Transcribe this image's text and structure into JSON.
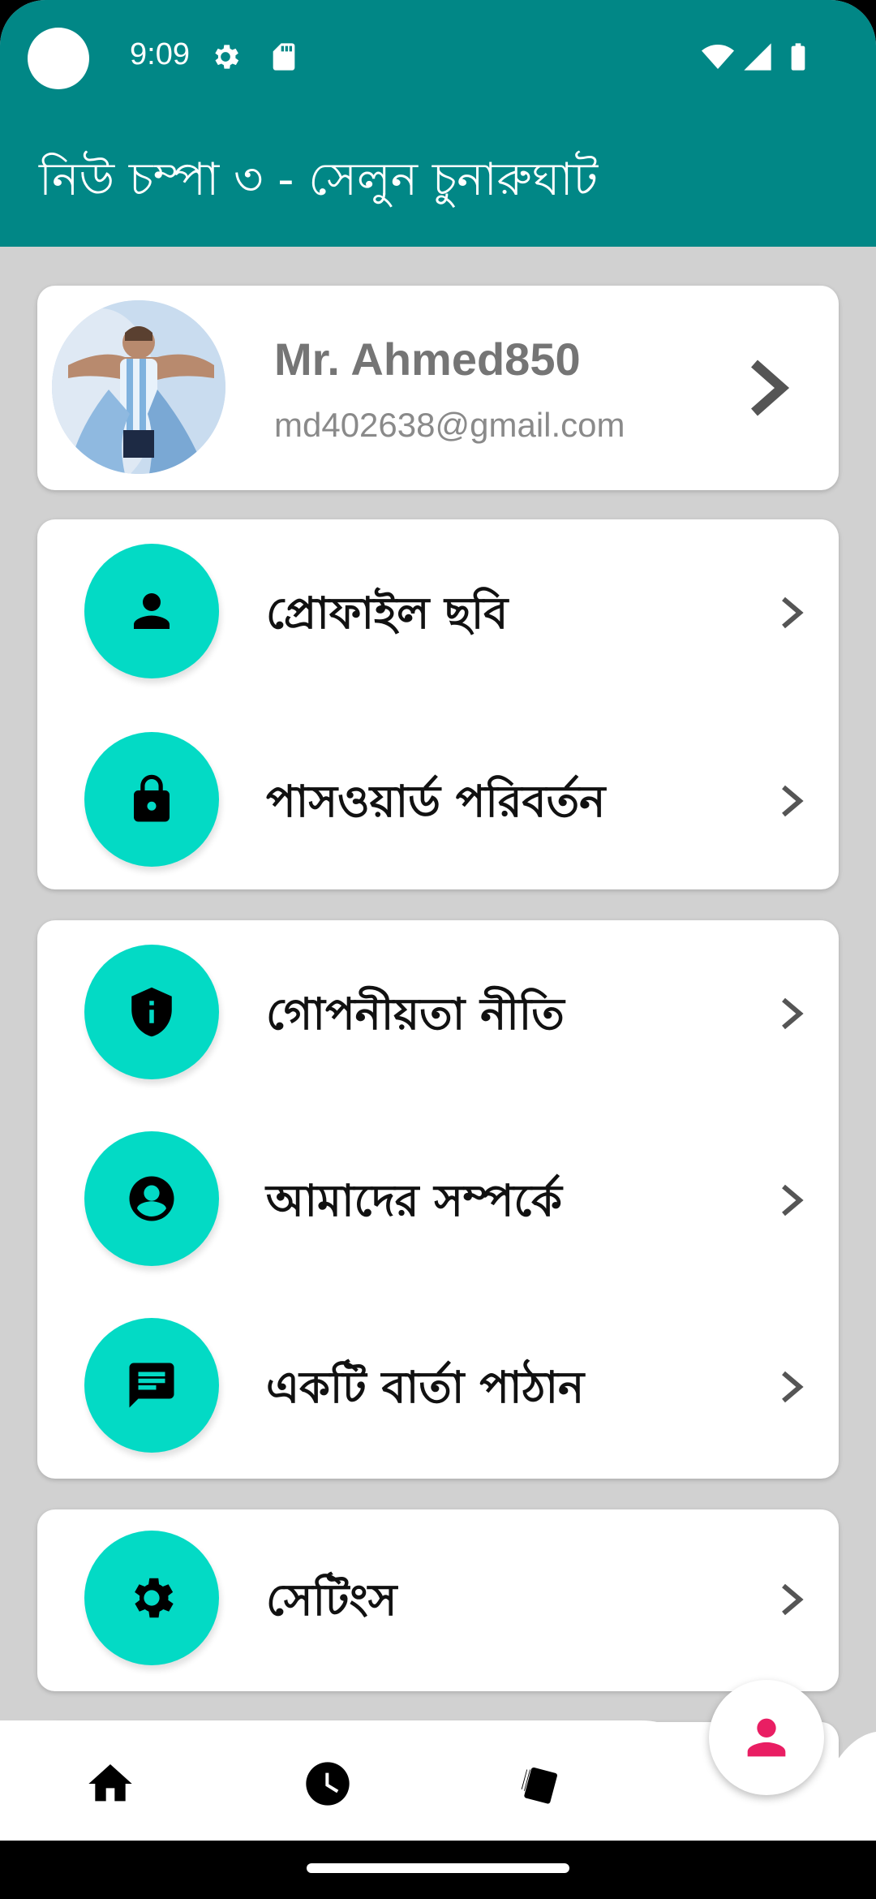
{
  "status_bar": {
    "time": "9:09",
    "icons": [
      "settings-gear-icon",
      "sd-card-icon",
      "wifi-icon",
      "signal-icon",
      "battery-icon"
    ]
  },
  "app_bar": {
    "title": "নিউ চম্পা ৩ - সেলুন চুনারুঘাট",
    "color": "#018786"
  },
  "profile": {
    "name": "Mr. Ahmed850",
    "email": "md402638@gmail.com"
  },
  "menu_groups": [
    {
      "items": [
        {
          "label": "প্রোফাইল ছবি",
          "icon": "person-icon"
        },
        {
          "label": "পাসওয়ার্ড পরিবর্তন",
          "icon": "lock-icon"
        }
      ]
    },
    {
      "items": [
        {
          "label": "গোপনীয়তা নীতি",
          "icon": "shield-info-icon"
        },
        {
          "label": "আমাদের সম্পর্কে",
          "icon": "account-circle-icon"
        },
        {
          "label": "একটি বার্তা পাঠান",
          "icon": "message-icon"
        }
      ]
    },
    {
      "items": [
        {
          "label": "সেটিংস",
          "icon": "gear-icon"
        }
      ]
    }
  ],
  "bottom_nav": {
    "items": [
      "home-icon",
      "history-clock-icon",
      "cards-icon",
      "profile-icon"
    ],
    "active_color": "#e91e63"
  },
  "colors": {
    "accent": "#03dac5",
    "background": "#d1d1d1"
  }
}
